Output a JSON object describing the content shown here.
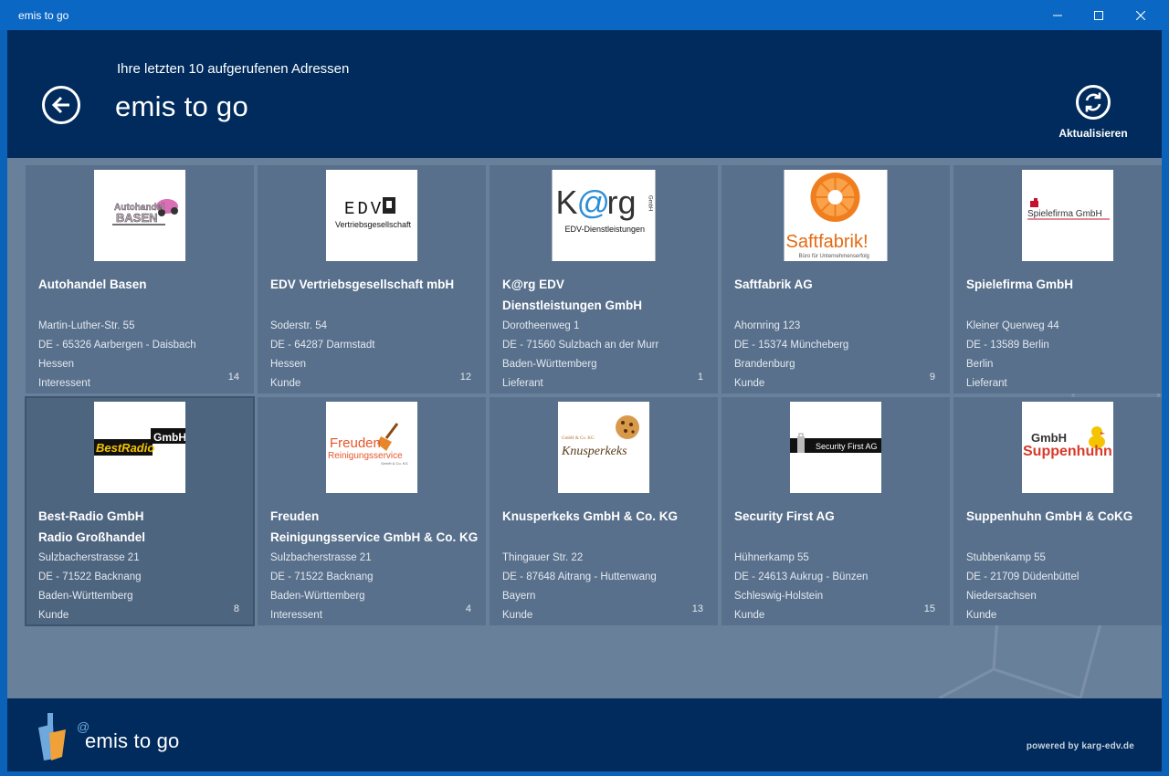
{
  "window": {
    "title": "emis to go"
  },
  "header": {
    "subtitle": "Ihre letzten 10 aufgerufenen Adressen",
    "title": "emis to go",
    "refresh_label": "Aktualisieren"
  },
  "cards": [
    {
      "name1": "Autohandel Basen",
      "name2": "",
      "street": "Martin-Luther-Str. 55",
      "city": "DE - 65326 Aarbergen - Daisbach",
      "state": "Hessen",
      "type": "Interessent",
      "count": "14",
      "logo_text": "Autohandel BASEN"
    },
    {
      "name1": "EDV Vertriebsgesellschaft mbH",
      "name2": "",
      "street": "Soderstr. 54",
      "city": "DE - 64287 Darmstadt",
      "state": "Hessen",
      "type": "Kunde",
      "count": "12",
      "logo_text": "EDV",
      "logo_sub": "Vertriebsgesellschaft"
    },
    {
      "name1": "K@rg EDV",
      "name2": "Dienstleistungen GmbH",
      "street": "Dorotheenweg 1",
      "city": "DE - 71560 Sulzbach an der Murr",
      "state": "Baden-Württemberg",
      "type": "Lieferant",
      "count": "1",
      "logo_text": "K@rg",
      "logo_sub": "EDV-Dienstleistungen",
      "logo_tag": "GmbH"
    },
    {
      "name1": "Saftfabrik AG",
      "name2": "",
      "street": "Ahornring 123",
      "city": "DE - 15374 Müncheberg",
      "state": "Brandenburg",
      "type": "Kunde",
      "count": "9",
      "logo_text": "Saftfabrik!",
      "logo_sub": "Büro für Unternehmenserfolg"
    },
    {
      "name1": "Spielefirma GmbH",
      "name2": "",
      "street": "Kleiner Querweg 44",
      "city": "DE - 13589 Berlin",
      "state": "Berlin",
      "type": "Lieferant",
      "count": "",
      "logo_text": "Spielefirma GmbH"
    },
    {
      "name1": "Best-Radio GmbH",
      "name2": "Radio Großhandel",
      "street": "Sulzbacherstrasse 21",
      "city": "DE - 71522 Backnang",
      "state": "Baden-Württemberg",
      "type": "Kunde",
      "count": "8",
      "logo_text": "BestRadio",
      "logo_tag": "GmbH"
    },
    {
      "name1": "Freuden",
      "name2": "Reinigungsservice GmbH & Co. KG",
      "street": "Sulzbacherstrasse 21",
      "city": "DE - 71522 Backnang",
      "state": "Baden-Württemberg",
      "type": "Interessent",
      "count": "4",
      "logo_text": "Freuden",
      "logo_sub": "Reinigungsservice",
      "logo_tag": "GmbH & Co. KG"
    },
    {
      "name1": "Knusperkeks GmbH & Co. KG",
      "name2": "",
      "street": "Thingauer Str. 22",
      "city": "DE - 87648 Aitrang - Huttenwang",
      "state": "Bayern",
      "type": "Kunde",
      "count": "13",
      "logo_text": "Knusperkeks",
      "logo_tag": "GmbH & Co. KG"
    },
    {
      "name1": "Security First AG",
      "name2": "",
      "street": "Hühnerkamp 55",
      "city": "DE - 24613 Aukrug - Bünzen",
      "state": "Schleswig-Holstein",
      "type": "Kunde",
      "count": "15",
      "logo_text": "Security First AG"
    },
    {
      "name1": "Suppenhuhn GmbH & CoKG",
      "name2": "",
      "street": "Stubbenkamp 55",
      "city": "DE - 21709 Düdenbüttel",
      "state": "Niedersachsen",
      "type": "Kunde",
      "count": "",
      "logo_text": "Suppenhuhn",
      "logo_tag": "GmbH"
    }
  ],
  "footer": {
    "app_name": "emis to go",
    "at_sign": "@",
    "powered": "powered by karg-edv.de"
  },
  "colors": {
    "titlebar": "#0a67c4",
    "header": "#002b5c",
    "content": "#69809b",
    "card": "#58708c"
  }
}
